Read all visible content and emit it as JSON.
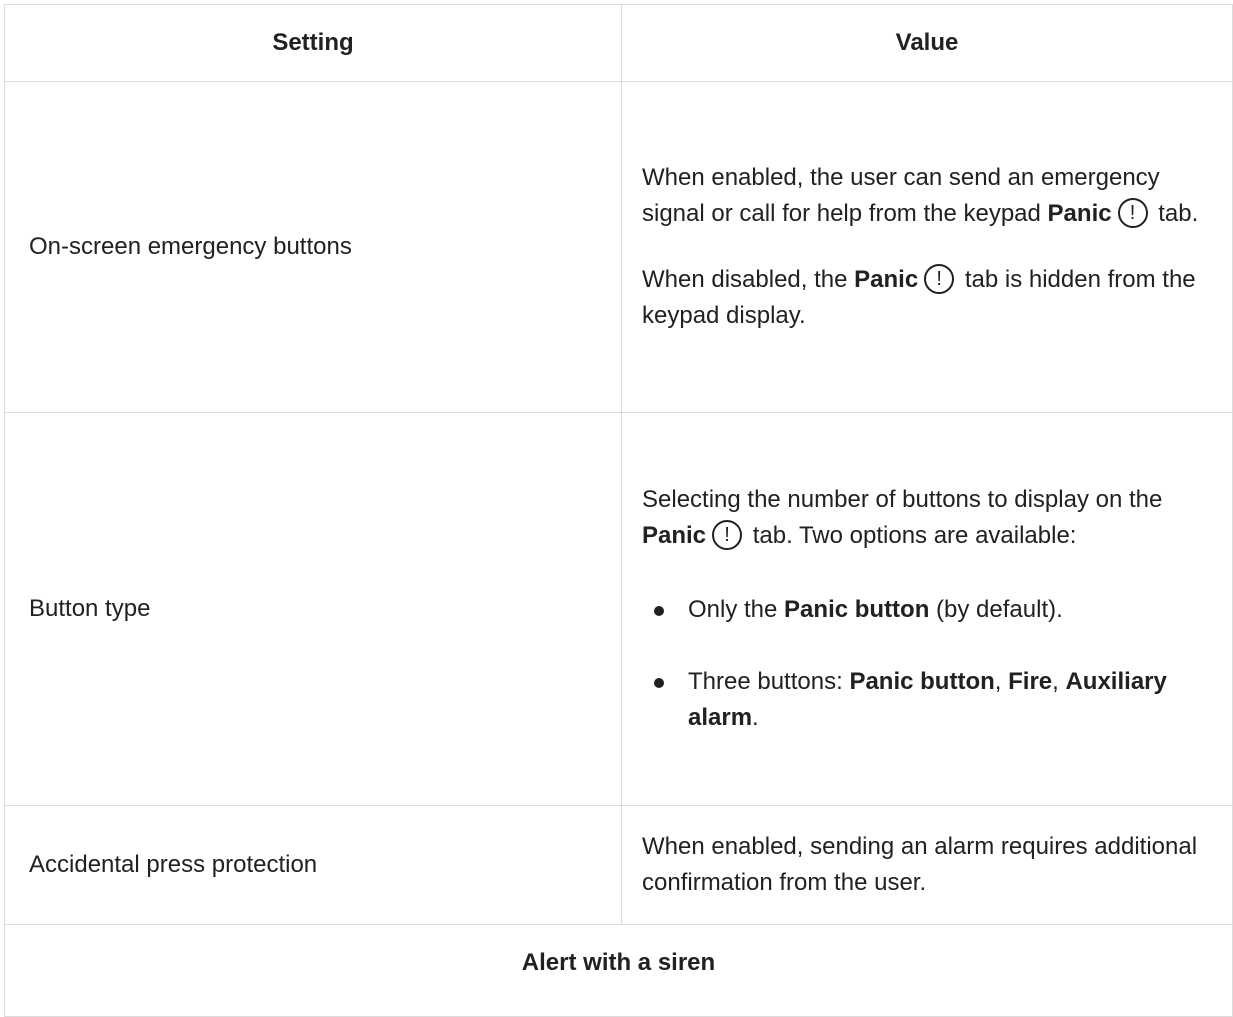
{
  "table": {
    "header": {
      "setting": "Setting",
      "value": "Value"
    },
    "rows": [
      {
        "setting": "On-screen emergency buttons",
        "p1_a": "When enabled, the user can send an emergency signal or call for help from the keypad ",
        "p1_b": "Panic",
        "p1_icon": "!",
        "p1_c": " tab.",
        "p2_a": "When disabled, the ",
        "p2_b": "Panic",
        "p2_icon": "!",
        "p2_c": " tab is hidden from the keypad display."
      },
      {
        "setting": "Button type",
        "p1_a": "Selecting the number of buttons to display on the ",
        "p1_b": "Panic",
        "p1_icon": "!",
        "p1_c": " tab. Two options are available:",
        "li1_a": "Only the ",
        "li1_b": "Panic button",
        "li1_c": " (by default).",
        "li2_a": "Three buttons: ",
        "li2_b": "Panic button",
        "li2_c": ", ",
        "li2_d": "Fire",
        "li2_e": ", ",
        "li2_f": "Auxiliary alarm",
        "li2_g": "."
      },
      {
        "setting": "Accidental press protection",
        "value": "When enabled, sending an alarm requires additional confirmation from the user."
      }
    ],
    "section_header": "Alert with a siren"
  }
}
